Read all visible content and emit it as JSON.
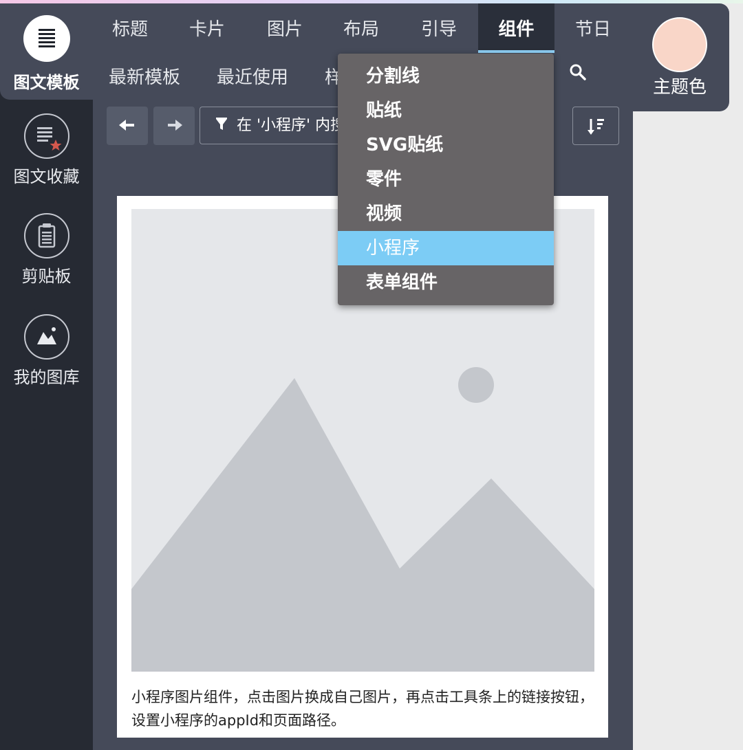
{
  "sidebar": {
    "items": [
      {
        "label": "图文模板",
        "icon": "document-lines-icon",
        "active": true
      },
      {
        "label": "图文收藏",
        "icon": "starred-document-icon"
      },
      {
        "label": "剪贴板",
        "icon": "clipboard-icon"
      },
      {
        "label": "我的图库",
        "icon": "image-gallery-icon"
      }
    ]
  },
  "tabs_row1": [
    "标题",
    "卡片",
    "图片",
    "布局",
    "引导",
    "组件",
    "节日"
  ],
  "tabs_row2": [
    "最新模板",
    "最近使用",
    "样"
  ],
  "active_tab": "组件",
  "theme": {
    "label": "主题色",
    "color": "#f9d6c8"
  },
  "toolbar": {
    "back_icon": "arrow-left-icon",
    "forward_icon": "arrow-right-icon",
    "filter_text": "在 '小程序' 内搜",
    "filter_icon": "funnel-icon",
    "sort_icon": "sort-icon",
    "search_icon": "search-icon"
  },
  "dropdown": {
    "items": [
      "分割线",
      "贴纸",
      "SVG贴纸",
      "零件",
      "视频",
      "小程序",
      "表单组件"
    ],
    "selected": "小程序"
  },
  "card": {
    "caption": "小程序图片组件，点击图片换成自己图片，再点击工具条上的链接按钮，设置小程序的appId和页面路径。"
  },
  "colors": {
    "accent": "#7cccf5",
    "sidebar_bg": "#262a33",
    "panel_bg": "#454a59",
    "dropdown_bg": "#676466"
  }
}
